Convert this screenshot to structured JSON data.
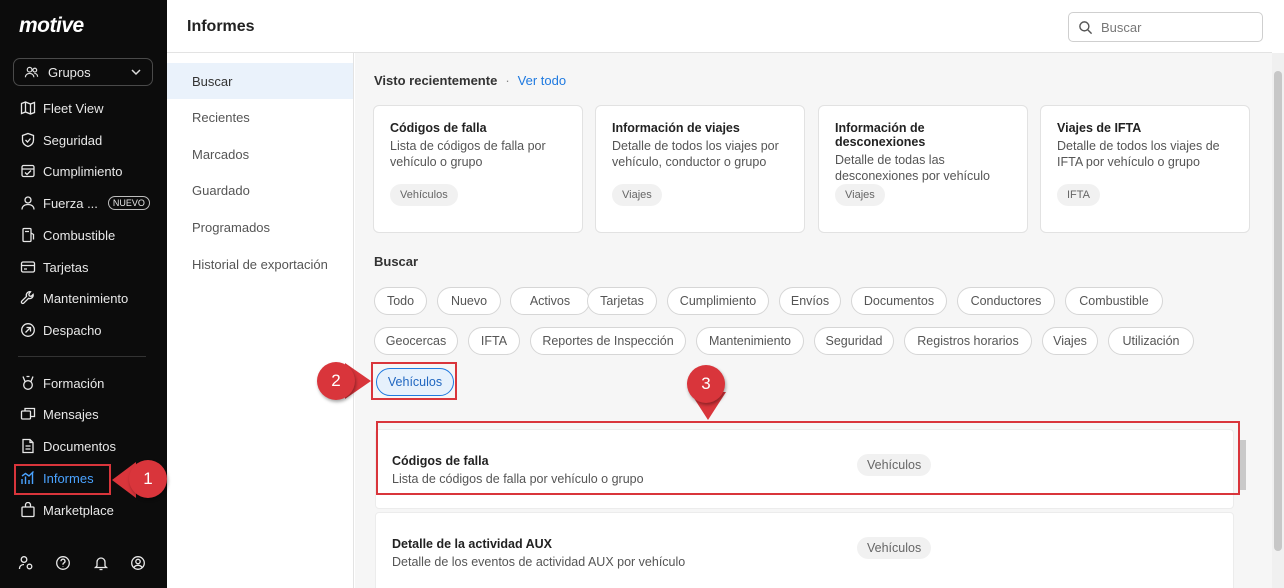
{
  "app": {
    "logo": "motive"
  },
  "sidebar": {
    "groups_label": "Grupos",
    "items": [
      {
        "label": "Fleet View",
        "icon": "map-icon"
      },
      {
        "label": "Seguridad",
        "icon": "shield-icon"
      },
      {
        "label": "Cumplimiento",
        "icon": "compliance-icon"
      },
      {
        "label": "Fuerza ...",
        "icon": "person-icon",
        "badge": "NUEVO"
      },
      {
        "label": "Combustible",
        "icon": "fuel-icon"
      },
      {
        "label": "Tarjetas",
        "icon": "card-icon"
      },
      {
        "label": "Mantenimiento",
        "icon": "wrench-icon"
      },
      {
        "label": "Despacho",
        "icon": "dispatch-icon"
      },
      {
        "label": "Formación",
        "icon": "training-icon"
      },
      {
        "label": "Mensajes",
        "icon": "messages-icon"
      },
      {
        "label": "Documentos",
        "icon": "document-icon"
      },
      {
        "label": "Informes",
        "icon": "chart-icon",
        "active": true
      },
      {
        "label": "Marketplace",
        "icon": "bag-icon"
      }
    ],
    "bottom_icons": [
      "users-settings-icon",
      "help-icon",
      "bell-icon",
      "account-icon"
    ]
  },
  "header": {
    "title": "Informes",
    "search_placeholder": "Buscar"
  },
  "subnav": {
    "items": [
      {
        "label": "Buscar",
        "active": true
      },
      {
        "label": "Recientes"
      },
      {
        "label": "Marcados"
      },
      {
        "label": "Guardado"
      },
      {
        "label": "Programados"
      },
      {
        "label": "Historial de exportación"
      }
    ]
  },
  "recent": {
    "title": "Visto recientemente",
    "separator": "·",
    "view_all": "Ver todo",
    "cards": [
      {
        "title": "Códigos de falla",
        "desc": "Lista de códigos de falla por vehículo o grupo",
        "tag": "Vehículos"
      },
      {
        "title": "Información de viajes",
        "desc": "Detalle de todos los viajes por vehículo, conductor o grupo",
        "tag": "Viajes"
      },
      {
        "title": "Información de desconexiones",
        "desc": "Detalle de todas las desconexiones por vehículo o…",
        "tag": "Viajes"
      },
      {
        "title": "Viajes de IFTA",
        "desc": "Detalle de todos los viajes de IFTA por vehículo o grupo",
        "tag": "IFTA"
      }
    ]
  },
  "search": {
    "title": "Buscar",
    "filters": [
      "Todo",
      "Nuevo",
      "Activos",
      "Tarjetas",
      "Cumplimiento",
      "Envíos",
      "Documentos",
      "Conductores",
      "Combustible",
      "Geocercas",
      "IFTA",
      "Reportes de Inspección",
      "Mantenimiento",
      "Seguridad",
      "Registros horarios",
      "Viajes",
      "Utilización",
      "Vehículos"
    ],
    "selected_filter": "Vehículos"
  },
  "results": [
    {
      "title": "Códigos de falla",
      "desc": "Lista de códigos de falla por vehículo o grupo",
      "tag": "Vehículos"
    },
    {
      "title": "Detalle de la actividad AUX",
      "desc": "Detalle de los eventos de actividad AUX por vehículo",
      "tag": "Vehículos"
    }
  ],
  "callouts": [
    "1",
    "2",
    "3"
  ],
  "colors": {
    "accent": "#1f7ae0",
    "callout": "#d9353b",
    "sidebar_bg": "#0c0c0c"
  }
}
